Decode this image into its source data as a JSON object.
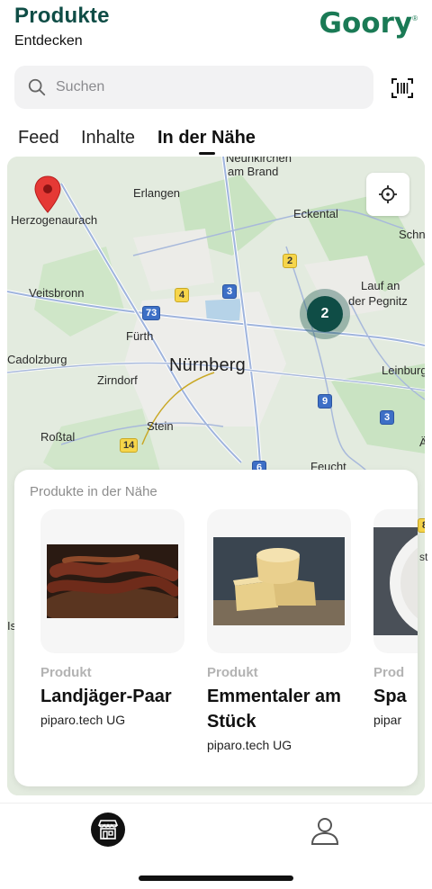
{
  "header": {
    "title": "Produkte",
    "subtitle": "Entdecken",
    "logo_text": "Goory",
    "logo_mark": "®"
  },
  "search": {
    "placeholder": "Suchen",
    "icon": "search-icon",
    "scan_icon": "barcode-scan-icon"
  },
  "tabs": [
    {
      "label": "Feed",
      "active": false
    },
    {
      "label": "Inhalte",
      "active": false
    },
    {
      "label": "In der Nähe",
      "active": true
    }
  ],
  "map": {
    "city_main": "Nürnberg",
    "labels": [
      "Neunkirchen",
      "am Brand",
      "Erlangen",
      "Herzogenaurach",
      "Eckental",
      "Schn",
      "Lauf an",
      "der Pegnitz",
      "Veitsbronn",
      "Fürth",
      "Cadolzburg",
      "Zirndorf",
      "Leinburg",
      "Stein",
      "Roßtal",
      "Feucht",
      "Ä",
      "Is"
    ],
    "routes": [
      {
        "label": "2",
        "color": "yellow"
      },
      {
        "label": "4",
        "color": "yellow"
      },
      {
        "label": "3",
        "color": "blue"
      },
      {
        "label": "73",
        "color": "blue"
      },
      {
        "label": "9",
        "color": "blue"
      },
      {
        "label": "3",
        "color": "blue"
      },
      {
        "label": "14",
        "color": "yellow"
      },
      {
        "label": "6",
        "color": "blue"
      },
      {
        "label": "8",
        "color": "yellow"
      }
    ],
    "cluster_count": "2",
    "locate_icon": "crosshair-icon",
    "pin_icon": "map-pin-icon"
  },
  "nearby": {
    "title": "Produkte in der Nähe",
    "cards": [
      {
        "type": "Produkt",
        "name": "Landjäger-Paar",
        "vendor": "piparo.tech UG"
      },
      {
        "type": "Produkt",
        "name": "Emmentaler am Stück",
        "vendor": "piparo.tech UG"
      },
      {
        "type": "Prod",
        "name": "Spa",
        "vendor": "pipar"
      }
    ],
    "partial_side_text": "st"
  },
  "bottom_nav": {
    "home_icon": "shop-icon",
    "profile_icon": "user-icon"
  },
  "colors": {
    "brand": "#0f4d46",
    "logo": "#1a7a55",
    "route_yellow": "#f6d54a",
    "route_blue": "#3d6fc6"
  }
}
